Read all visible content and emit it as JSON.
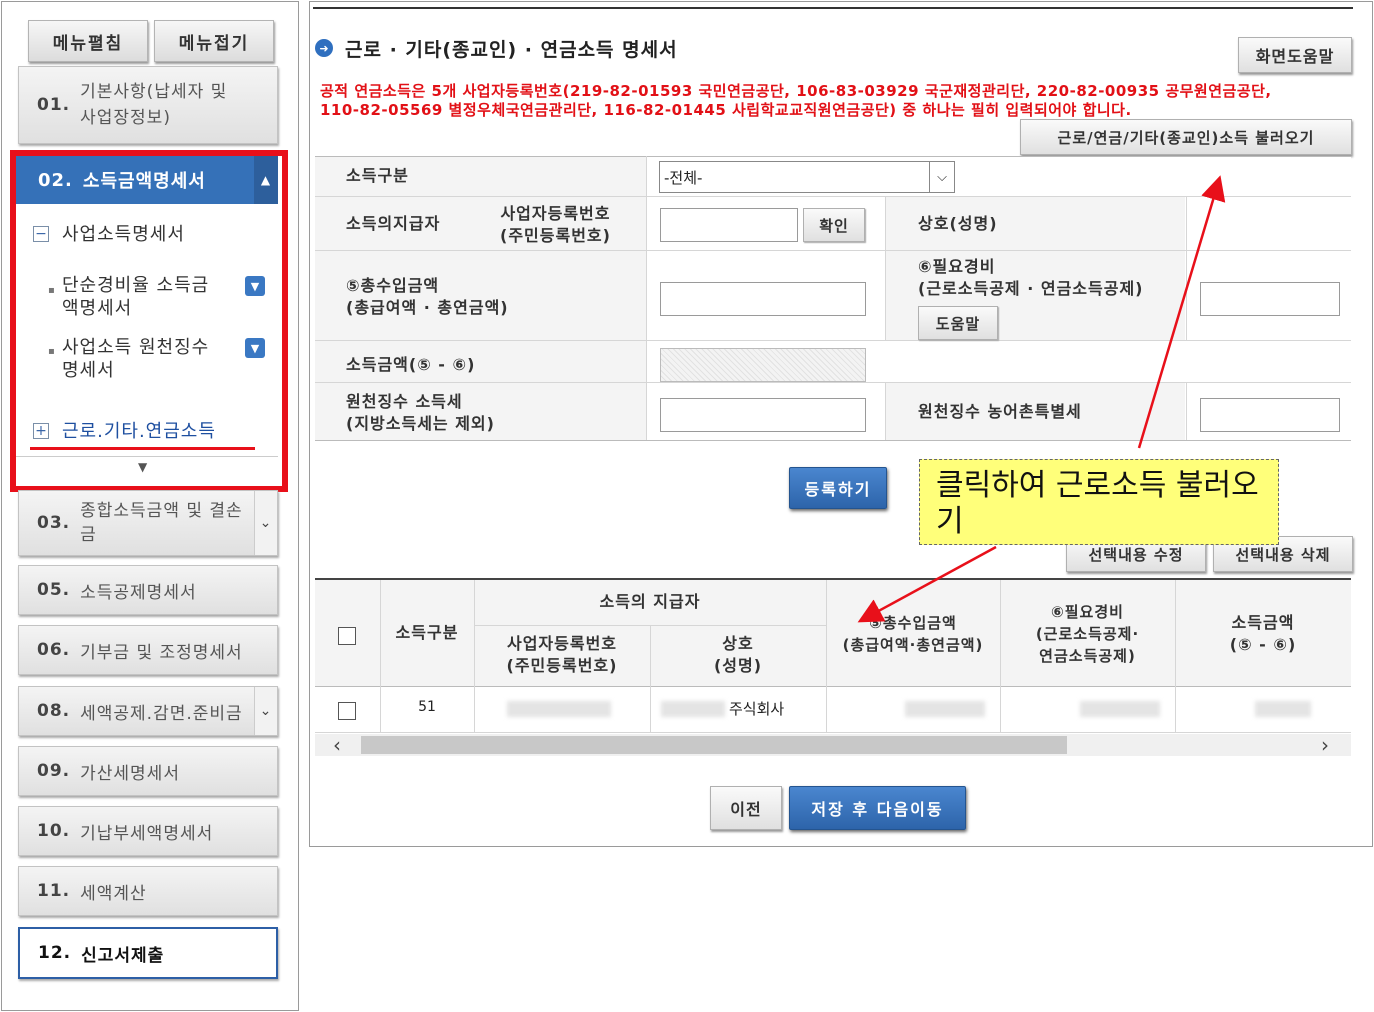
{
  "sidebar": {
    "expand_label": "메뉴펼침",
    "collapse_label": "메뉴접기",
    "items": [
      {
        "num": "01.",
        "label": "기본사항(납세자 및 사업장정보)"
      },
      {
        "num": "02.",
        "label": "소득금액명세서"
      },
      {
        "num": "03.",
        "label": "종합소득금액 및 결손금"
      },
      {
        "num": "05.",
        "label": "소득공제명세서"
      },
      {
        "num": "06.",
        "label": "기부금 및 조정명세서"
      },
      {
        "num": "08.",
        "label": "세액공제.감면.준비금"
      },
      {
        "num": "09.",
        "label": "가산세명세서"
      },
      {
        "num": "10.",
        "label": "기납부세액명세서"
      },
      {
        "num": "11.",
        "label": "세액계산"
      },
      {
        "num": "12.",
        "label": "신고서제출"
      }
    ],
    "item01_line1": "기본사항(납세자 및",
    "item01_line2": "사업장정보)",
    "item03_line1": "종합소득금액 및 결손",
    "item03_line2": "금",
    "item08_text": "세액공제.감면.준비금",
    "sub": {
      "business_income": "사업소득명세서",
      "simple_rate_line1": "단순경비율 소득금",
      "simple_rate_line2": "액명세서",
      "withholding_line1": "사업소득 원천징수",
      "withholding_line2": "명세서",
      "labor_pension": "근로.기타.연금소득"
    }
  },
  "main": {
    "title": "근로 · 기타(종교인) · 연금소득 명세서",
    "help_button": "화면도움말",
    "notice_line1": "공적 연금소득은 5개 사업자등록번호(219-82-01593 국민연금공단, 106-83-03929 국군재정관리단, 220-82-00935 공무원연금공단,",
    "notice_line2": "110-82-05569 별정우체국연금관리단, 116-82-01445 사립학교교직원연금공단) 중 하나는 필히 입력되어야 합니다.",
    "load_button": "근로/연금/기타(종교인)소득 불러오기",
    "form": {
      "income_type_label": "소득구분",
      "income_type_value": "-전체-",
      "payer_label": "소득의지급자",
      "bizno_label_line1": "사업자등록번호",
      "bizno_label_line2": "(주민등록번호)",
      "confirm_button": "확인",
      "company_label": "상호(성명)",
      "total_income_line1": "⑤총수입금액",
      "total_income_line2": "(총급여액 · 총연금액)",
      "expense_line1": "⑥필요경비",
      "expense_line2": "(근로소득공제 · 연금소득공제)",
      "help_small_button": "도움말",
      "income_amount_label": "소득금액(⑤ - ⑥)",
      "withholding_line1": "원천징수 소득세",
      "withholding_line2": "(지방소득세는 제외)",
      "rural_tax_label": "원천징수 농어촌특별세"
    },
    "register_button": "등록하기",
    "edit_button": "선택내용 수정",
    "delete_button": "선택내용 삭제",
    "callout_text": "클릭하여 근로소득 불러오기",
    "table": {
      "col_income_type": "소득구분",
      "col_payer_group": "소득의 지급자",
      "col_bizno_line1": "사업자등록번호",
      "col_bizno_line2": "(주민등록번호)",
      "col_company_line1": "상호",
      "col_company_line2": "(성명)",
      "col_total_line1": "⑤총수입금액",
      "col_total_line2": "(총급여액·총연금액)",
      "col_expense_line1": "⑥필요경비",
      "col_expense_line2": "(근로소득공제·",
      "col_expense_line3": "연금소득공제)",
      "col_income_line1": "소득금액",
      "col_income_line2": "(⑤ - ⑥)",
      "rows": [
        {
          "income_type": "51",
          "company": "주식회사"
        }
      ]
    },
    "prev_button": "이전",
    "save_next_button": "저장 후 다음이동"
  },
  "colors": {
    "accent_blue": "#3571b8",
    "highlight_red": "#e8101a",
    "callout_yellow": "#ffff7a"
  }
}
